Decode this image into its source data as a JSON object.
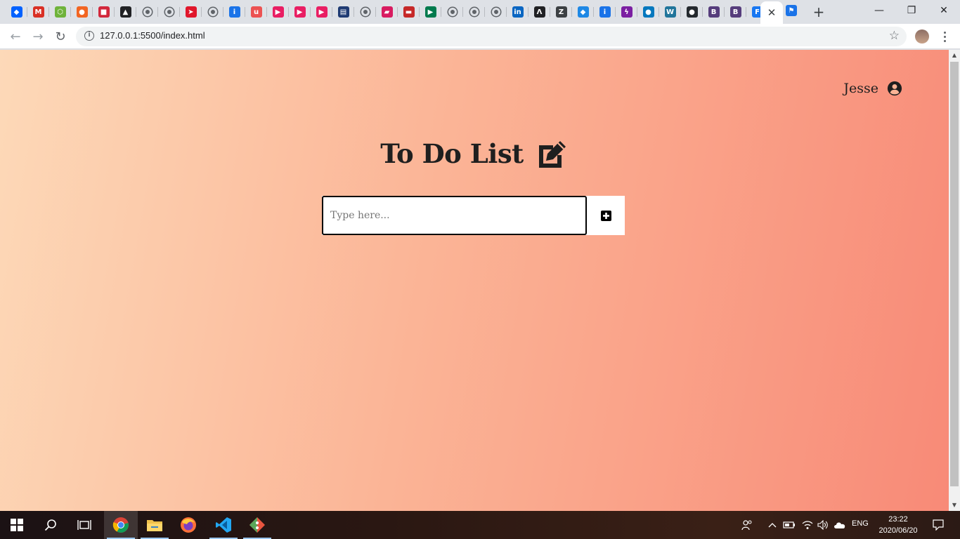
{
  "browser": {
    "pinned_tabs": [
      {
        "icon": "dropbox-icon",
        "color": "#0061ff",
        "glyph": "◆"
      },
      {
        "icon": "gmail-icon",
        "color": "#d93025",
        "glyph": "M"
      },
      {
        "icon": "hex-icon",
        "color": "#6fb33b",
        "glyph": "⬡"
      },
      {
        "icon": "people-icon",
        "color": "#f26522",
        "glyph": "●"
      },
      {
        "icon": "bus-icon",
        "color": "#d2283c",
        "glyph": "■"
      },
      {
        "icon": "arch-icon",
        "color": "#202124",
        "glyph": "▲"
      },
      {
        "icon": "globe-icon",
        "color": "#5f6368",
        "glyph": ""
      },
      {
        "icon": "globe-icon",
        "color": "#5f6368",
        "glyph": ""
      },
      {
        "icon": "flag-red-icon",
        "color": "#e0162b",
        "glyph": "➤"
      },
      {
        "icon": "globe-icon",
        "color": "#5f6368",
        "glyph": ""
      },
      {
        "icon": "info-blue-icon",
        "color": "#1a73e8",
        "glyph": "i"
      },
      {
        "icon": "udemy-icon",
        "color": "#ec5252",
        "glyph": "u"
      },
      {
        "icon": "play-red-icon",
        "color": "#e91e63",
        "glyph": "▶"
      },
      {
        "icon": "play-red-icon",
        "color": "#e91e63",
        "glyph": "▶"
      },
      {
        "icon": "play-red-icon",
        "color": "#e91e63",
        "glyph": "▶"
      },
      {
        "icon": "news-icon",
        "color": "#1f3b73",
        "glyph": "▤"
      },
      {
        "icon": "globe-icon",
        "color": "#5f6368",
        "glyph": ""
      },
      {
        "icon": "graduation-icon",
        "color": "#d81b60",
        "glyph": "▰"
      },
      {
        "icon": "plane-icon",
        "color": "#c62828",
        "glyph": "▬"
      },
      {
        "icon": "south-africa-flag-icon",
        "color": "#007a4d",
        "glyph": "▶"
      },
      {
        "icon": "globe-icon",
        "color": "#5f6368",
        "glyph": ""
      },
      {
        "icon": "globe-icon",
        "color": "#5f6368",
        "glyph": ""
      },
      {
        "icon": "globe-icon",
        "color": "#5f6368",
        "glyph": ""
      },
      {
        "icon": "linkedin-icon",
        "color": "#0a66c2",
        "glyph": "in"
      },
      {
        "icon": "lambda-icon",
        "color": "#202124",
        "glyph": "Λ"
      },
      {
        "icon": "z-icon",
        "color": "#3c4043",
        "glyph": "Z"
      },
      {
        "icon": "cube-blue-icon",
        "color": "#1e88e5",
        "glyph": "◆"
      },
      {
        "icon": "info-blue-icon",
        "color": "#1a73e8",
        "glyph": "i"
      },
      {
        "icon": "bolt-icon",
        "color": "#7b1fa2",
        "glyph": "ϟ"
      },
      {
        "icon": "drupal-icon",
        "color": "#0678be",
        "glyph": "●"
      },
      {
        "icon": "wordpress-icon",
        "color": "#21759b",
        "glyph": "W"
      },
      {
        "icon": "github-icon",
        "color": "#24292e",
        "glyph": "●"
      },
      {
        "icon": "bootstrap-icon",
        "color": "#563d7c",
        "glyph": "B"
      },
      {
        "icon": "bootstrap-icon",
        "color": "#563d7c",
        "glyph": "B"
      },
      {
        "icon": "facebook-icon",
        "color": "#1877f2",
        "glyph": "F"
      }
    ],
    "active_tab_close": "✕",
    "extra_tab": {
      "icon": "flag-blue-icon",
      "color": "#1a73e8",
      "glyph": "⚑"
    },
    "new_tab_symbol": "+",
    "window_controls": {
      "minimize": "—",
      "restore": "❐",
      "close": "✕"
    },
    "url": "127.0.0.1:5500/index.html",
    "nav": {
      "back": "←",
      "forward": "→",
      "reload": "↻"
    },
    "bookmark_symbol": "☆",
    "info_symbol": "i"
  },
  "page": {
    "user_name": "Jesse",
    "title": "To Do List",
    "input_placeholder": "Type here...",
    "background_colors": [
      "#fdd9b8",
      "#f88a77"
    ]
  },
  "taskbar": {
    "apps": [
      {
        "name": "chrome",
        "icon": "chrome-icon",
        "active": true
      },
      {
        "name": "file-explorer",
        "icon": "folder-icon",
        "active": false
      },
      {
        "name": "firefox",
        "icon": "firefox-icon",
        "active": false
      },
      {
        "name": "vscode",
        "icon": "vscode-icon",
        "active": false
      },
      {
        "name": "git",
        "icon": "git-icon",
        "active": false
      }
    ],
    "language": "ENG",
    "time": "23:22",
    "date": "2020/06/20"
  }
}
